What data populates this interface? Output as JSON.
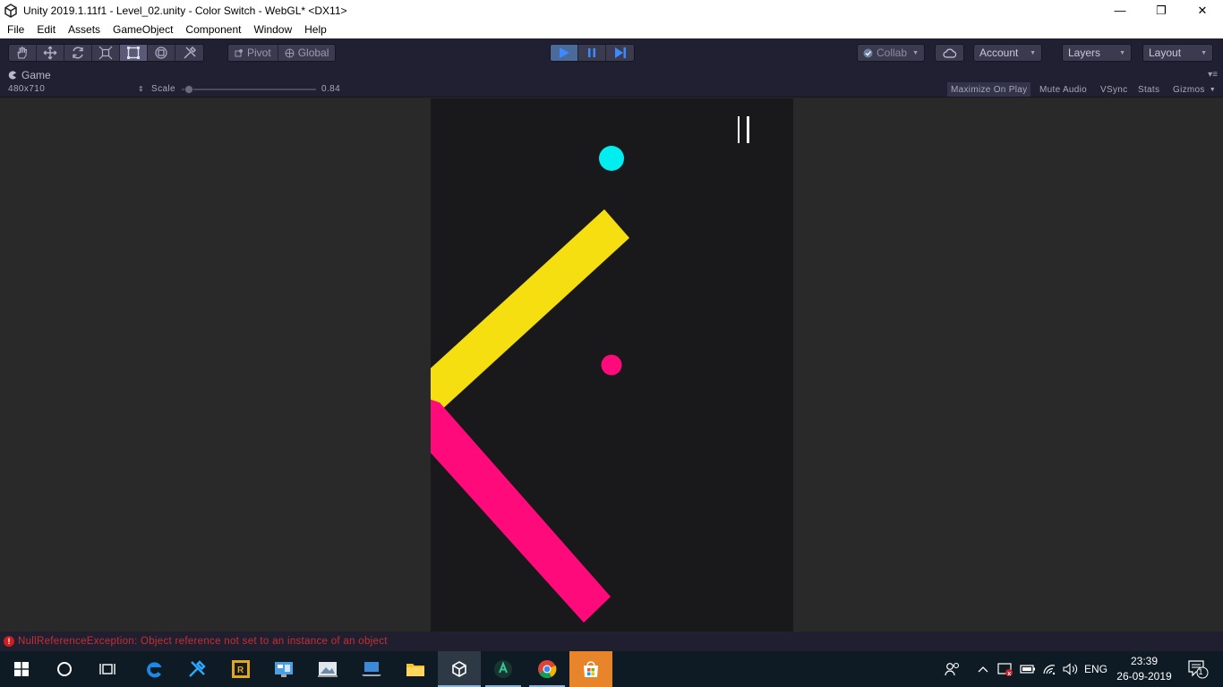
{
  "window": {
    "title": "Unity 2019.1.11f1 - Level_02.unity - Color Switch - WebGL* <DX11>",
    "minimize_glyph": "—",
    "restore_glyph": "❐",
    "close_glyph": "✕"
  },
  "menu": [
    "File",
    "Edit",
    "Assets",
    "GameObject",
    "Component",
    "Window",
    "Help"
  ],
  "toolbar": {
    "tools": [
      "hand-tool-icon",
      "move-tool-icon",
      "rotate-tool-icon",
      "scale-tool-icon",
      "rect-tool-icon",
      "transform-tool-icon",
      "custom-tool-icon"
    ],
    "active_tool_index": 4,
    "pivot_label": "Pivot",
    "global_label": "Global",
    "play_active": true,
    "collab_label": "Collab",
    "account_label": "Account",
    "layers_label": "Layers",
    "layout_label": "Layout"
  },
  "game_tab": {
    "label": "Game",
    "menu_glyph": "▾≡"
  },
  "game_controls": {
    "resolution": "480x710",
    "scale_label": "Scale",
    "scale_value": "0.84",
    "scale_fraction": 0.02,
    "maximize_on_play": "Maximize On Play",
    "mute_audio": "Mute Audio",
    "vsync": "VSync",
    "stats": "Stats",
    "gizmos": "Gizmos"
  },
  "game_scene": {
    "pause_glyph": "||",
    "colors": {
      "cyan": "#00eef0",
      "yellow": "#f5df10",
      "pink": "#ff0a7a",
      "background": "#19191b"
    }
  },
  "status": {
    "error_text": "NullReferenceException: Object reference not set to an instance of an object"
  },
  "taskbar": {
    "apps": [
      "windows-start-icon",
      "cortana-icon",
      "task-view-icon",
      "edge-icon",
      "tools-icon",
      "rider-icon",
      "control-panel-icon",
      "photos-icon",
      "laptop-icon",
      "file-explorer-icon",
      "unity-icon",
      "gamemaker-icon",
      "chrome-icon",
      "store-icon"
    ],
    "language": "ENG",
    "time": "23:39",
    "date": "26-09-2019",
    "notification_count": "1"
  }
}
